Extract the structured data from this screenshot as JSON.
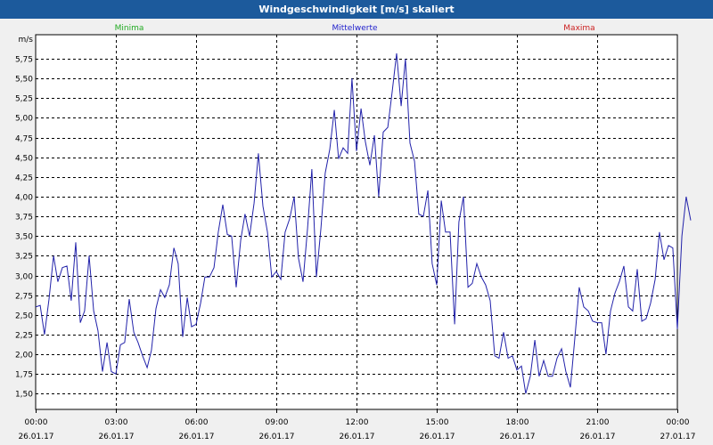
{
  "window": {
    "title": "Windgeschwindigkeit [m/s] skaliert"
  },
  "legend": [
    {
      "label": "Minima",
      "color": "#22aa22"
    },
    {
      "label": "Mittelwerte",
      "color": "#2222cc"
    },
    {
      "label": "Maxima",
      "color": "#cc2222"
    }
  ],
  "chart_data": {
    "type": "line",
    "title": "Windgeschwindigkeit [m/s] skaliert",
    "ylabel": "m/s",
    "ylim": [
      1.3,
      6.0
    ],
    "yticks": [
      "1,50",
      "1,75",
      "2,00",
      "2,25",
      "2,50",
      "2,75",
      "3,00",
      "3,25",
      "3,50",
      "3,75",
      "4,00",
      "4,25",
      "4,50",
      "4,75",
      "5,00",
      "5,25",
      "5,50",
      "5,75"
    ],
    "ytick_values": [
      1.5,
      1.75,
      2.0,
      2.25,
      2.5,
      2.75,
      3.0,
      3.25,
      3.5,
      3.75,
      4.0,
      4.25,
      4.5,
      4.75,
      5.0,
      5.25,
      5.5,
      5.75
    ],
    "xlim_hours": [
      0,
      24
    ],
    "xticks": [
      {
        "time": "00:00",
        "date": "26.01.17",
        "hour": 0
      },
      {
        "time": "03:00",
        "date": "26.01.17",
        "hour": 3
      },
      {
        "time": "06:00",
        "date": "26.01.17",
        "hour": 6
      },
      {
        "time": "09:00",
        "date": "26.01.17",
        "hour": 9
      },
      {
        "time": "12:00",
        "date": "26.01.17",
        "hour": 12
      },
      {
        "time": "15:00",
        "date": "26.01.17",
        "hour": 15
      },
      {
        "time": "18:00",
        "date": "26.01.17",
        "hour": 18
      },
      {
        "time": "21:00",
        "date": "26.01.17",
        "hour": 21
      },
      {
        "time": "00:00",
        "date": "27.01.17",
        "hour": 24
      }
    ],
    "grid": true,
    "series": [
      {
        "name": "Mittelwerte",
        "color": "#2222aa",
        "points": [
          [
            0.0,
            2.6
          ],
          [
            0.17,
            2.62
          ],
          [
            0.33,
            2.25
          ],
          [
            0.5,
            2.7
          ],
          [
            0.67,
            3.25
          ],
          [
            0.83,
            2.92
          ],
          [
            1.0,
            3.1
          ],
          [
            1.17,
            3.12
          ],
          [
            1.33,
            2.68
          ],
          [
            1.5,
            3.42
          ],
          [
            1.67,
            2.4
          ],
          [
            1.83,
            2.55
          ],
          [
            2.0,
            3.25
          ],
          [
            2.17,
            2.55
          ],
          [
            2.33,
            2.3
          ],
          [
            2.5,
            1.78
          ],
          [
            2.67,
            2.15
          ],
          [
            2.83,
            1.78
          ],
          [
            3.0,
            1.75
          ],
          [
            3.17,
            2.12
          ],
          [
            3.33,
            2.15
          ],
          [
            3.5,
            2.7
          ],
          [
            3.67,
            2.28
          ],
          [
            3.83,
            2.15
          ],
          [
            4.0,
            1.98
          ],
          [
            4.17,
            1.83
          ],
          [
            4.33,
            2.05
          ],
          [
            4.5,
            2.58
          ],
          [
            4.67,
            2.82
          ],
          [
            4.83,
            2.72
          ],
          [
            5.0,
            2.88
          ],
          [
            5.17,
            3.35
          ],
          [
            5.33,
            3.15
          ],
          [
            5.5,
            2.22
          ],
          [
            5.67,
            2.72
          ],
          [
            5.83,
            2.35
          ],
          [
            6.0,
            2.38
          ],
          [
            6.17,
            2.65
          ],
          [
            6.33,
            2.98
          ],
          [
            6.5,
            2.98
          ],
          [
            6.67,
            3.1
          ],
          [
            6.83,
            3.55
          ],
          [
            7.0,
            3.9
          ],
          [
            7.17,
            3.52
          ],
          [
            7.33,
            3.5
          ],
          [
            7.5,
            2.85
          ],
          [
            7.67,
            3.45
          ],
          [
            7.83,
            3.78
          ],
          [
            8.0,
            3.5
          ],
          [
            8.17,
            3.92
          ],
          [
            8.33,
            4.55
          ],
          [
            8.5,
            3.88
          ],
          [
            8.67,
            3.55
          ],
          [
            8.83,
            2.98
          ],
          [
            9.0,
            3.05
          ],
          [
            9.17,
            2.95
          ],
          [
            9.33,
            3.55
          ],
          [
            9.5,
            3.72
          ],
          [
            9.67,
            4.0
          ],
          [
            9.83,
            3.22
          ],
          [
            10.0,
            2.92
          ],
          [
            10.17,
            3.6
          ],
          [
            10.33,
            4.35
          ],
          [
            10.5,
            2.98
          ],
          [
            10.67,
            3.6
          ],
          [
            10.83,
            4.3
          ],
          [
            11.0,
            4.6
          ],
          [
            11.17,
            5.1
          ],
          [
            11.33,
            4.48
          ],
          [
            11.5,
            4.62
          ],
          [
            11.67,
            4.55
          ],
          [
            11.83,
            5.5
          ],
          [
            12.0,
            4.58
          ],
          [
            12.17,
            5.12
          ],
          [
            12.33,
            4.7
          ],
          [
            12.5,
            4.4
          ],
          [
            12.67,
            4.78
          ],
          [
            12.83,
            4.0
          ],
          [
            13.0,
            4.82
          ],
          [
            13.17,
            4.88
          ],
          [
            13.33,
            5.32
          ],
          [
            13.5,
            5.82
          ],
          [
            13.67,
            5.15
          ],
          [
            13.83,
            5.75
          ],
          [
            14.0,
            4.68
          ],
          [
            14.17,
            4.45
          ],
          [
            14.33,
            3.78
          ],
          [
            14.5,
            3.75
          ],
          [
            14.67,
            4.08
          ],
          [
            14.83,
            3.15
          ],
          [
            15.0,
            2.88
          ],
          [
            15.17,
            3.95
          ],
          [
            15.33,
            3.55
          ],
          [
            15.5,
            3.55
          ],
          [
            15.67,
            2.38
          ],
          [
            15.83,
            3.68
          ],
          [
            16.0,
            4.0
          ],
          [
            16.17,
            2.85
          ],
          [
            16.33,
            2.9
          ],
          [
            16.5,
            3.15
          ],
          [
            16.67,
            2.98
          ],
          [
            16.83,
            2.88
          ],
          [
            17.0,
            2.68
          ],
          [
            17.17,
            1.98
          ],
          [
            17.33,
            1.95
          ],
          [
            17.5,
            2.28
          ],
          [
            17.67,
            1.95
          ],
          [
            17.83,
            1.98
          ],
          [
            18.0,
            1.8
          ],
          [
            18.17,
            1.85
          ],
          [
            18.33,
            1.5
          ],
          [
            18.5,
            1.72
          ],
          [
            18.67,
            2.18
          ],
          [
            18.83,
            1.72
          ],
          [
            19.0,
            1.92
          ],
          [
            19.17,
            1.72
          ],
          [
            19.33,
            1.72
          ],
          [
            19.5,
            1.95
          ],
          [
            19.67,
            2.07
          ],
          [
            19.83,
            1.78
          ],
          [
            20.0,
            1.58
          ],
          [
            20.17,
            2.22
          ],
          [
            20.33,
            2.85
          ],
          [
            20.5,
            2.6
          ],
          [
            20.67,
            2.55
          ],
          [
            20.83,
            2.42
          ],
          [
            21.0,
            2.4
          ],
          [
            21.17,
            2.4
          ],
          [
            21.33,
            2.0
          ],
          [
            21.5,
            2.55
          ],
          [
            21.67,
            2.78
          ],
          [
            21.83,
            2.92
          ],
          [
            22.0,
            3.12
          ],
          [
            22.17,
            2.6
          ],
          [
            22.33,
            2.55
          ],
          [
            22.5,
            3.08
          ],
          [
            22.67,
            2.42
          ],
          [
            22.83,
            2.45
          ],
          [
            23.0,
            2.65
          ],
          [
            23.17,
            2.95
          ],
          [
            23.33,
            3.55
          ],
          [
            23.5,
            3.2
          ],
          [
            23.67,
            3.38
          ],
          [
            23.83,
            3.35
          ],
          [
            24.0,
            2.32
          ],
          [
            24.17,
            3.5
          ],
          [
            24.33,
            4.0
          ],
          [
            24.5,
            3.7
          ]
        ]
      }
    ]
  }
}
